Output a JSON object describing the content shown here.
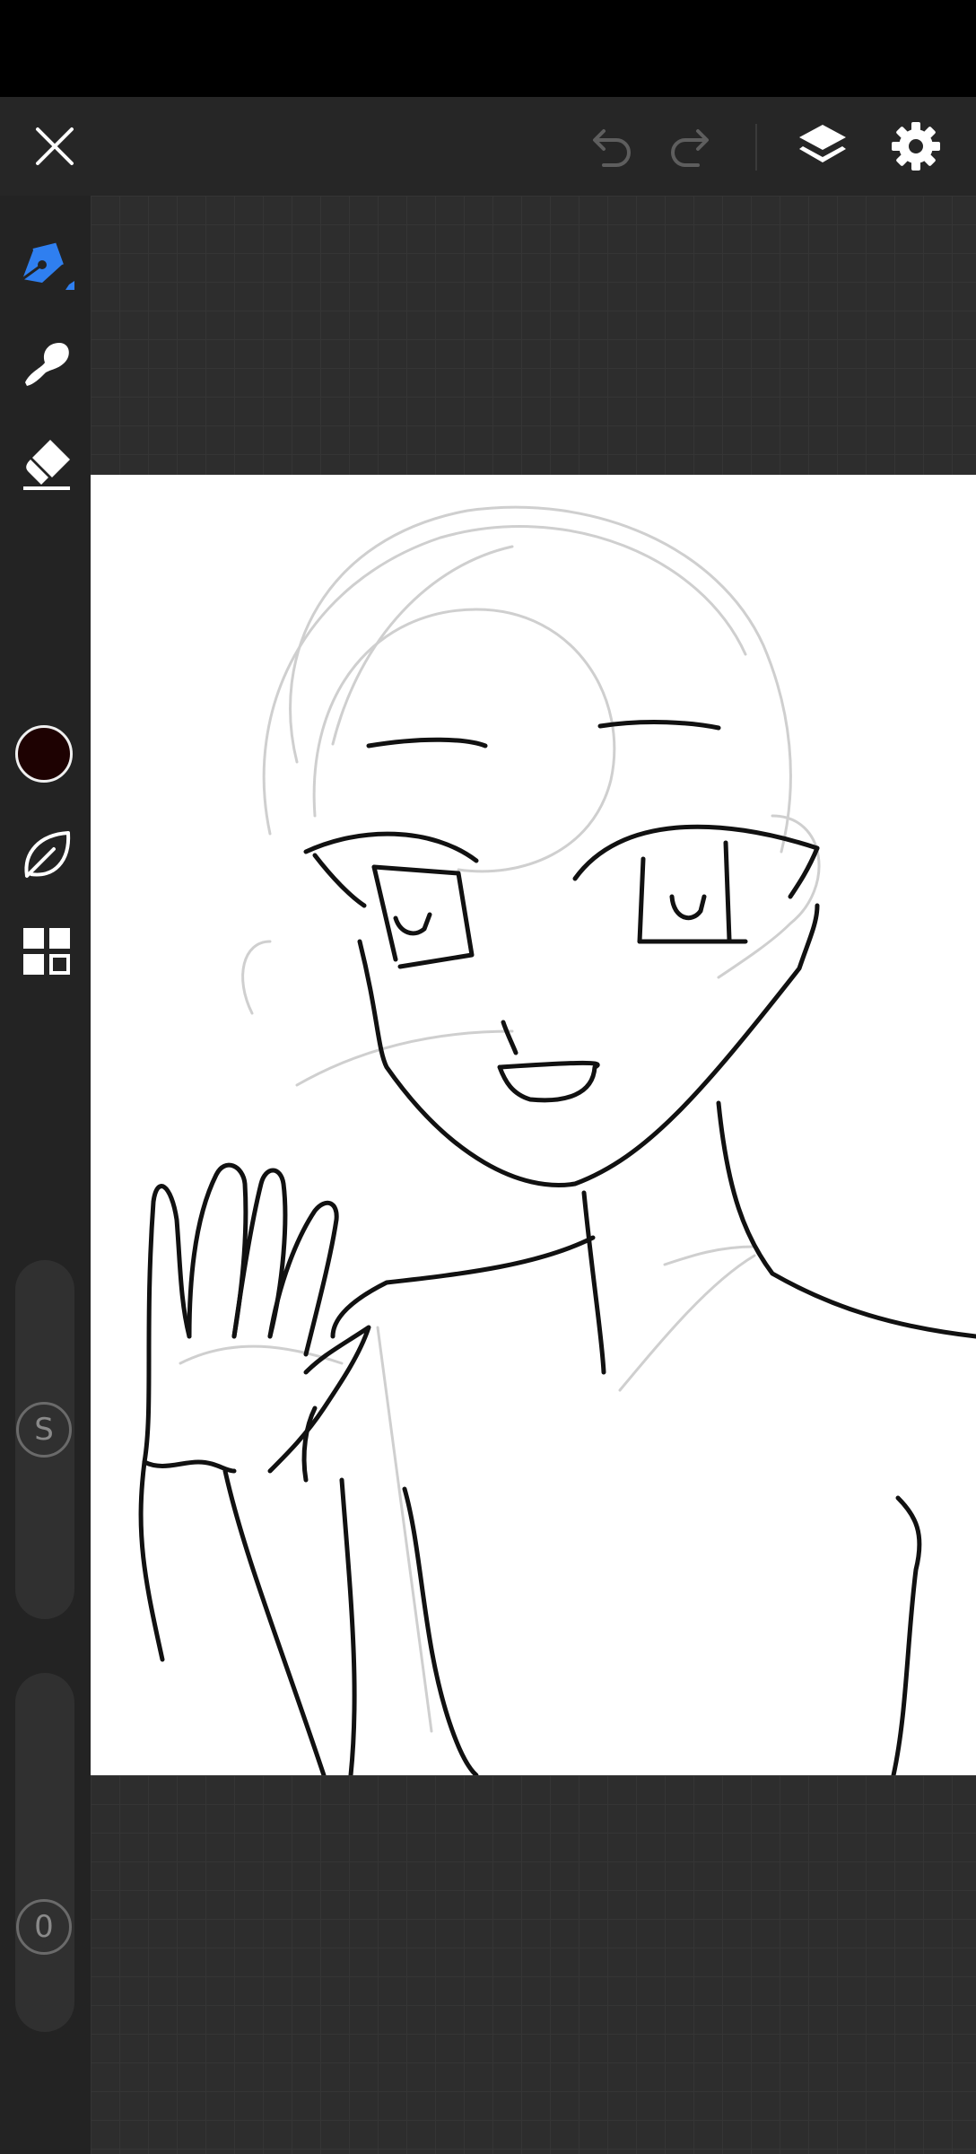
{
  "colors": {
    "current_color": "#1e0202",
    "accent": "#3b82f6"
  },
  "toolbar": {
    "close_icon": "close-icon",
    "undo_icon": "undo-icon",
    "redo_icon": "redo-icon",
    "layers_icon": "layers-icon",
    "settings_icon": "gear-icon"
  },
  "tools": [
    {
      "name": "pen-tool",
      "icon": "pen-icon"
    },
    {
      "name": "smudge-tool",
      "icon": "smudge-icon"
    },
    {
      "name": "eraser-tool",
      "icon": "eraser-icon"
    },
    {
      "name": "color-picker",
      "icon": "color-swatch"
    },
    {
      "name": "brush-library",
      "icon": "leaf-icon"
    },
    {
      "name": "grid-menu",
      "icon": "grid-icon"
    }
  ],
  "sliders": {
    "size_label": "S",
    "opacity_label": "0"
  }
}
